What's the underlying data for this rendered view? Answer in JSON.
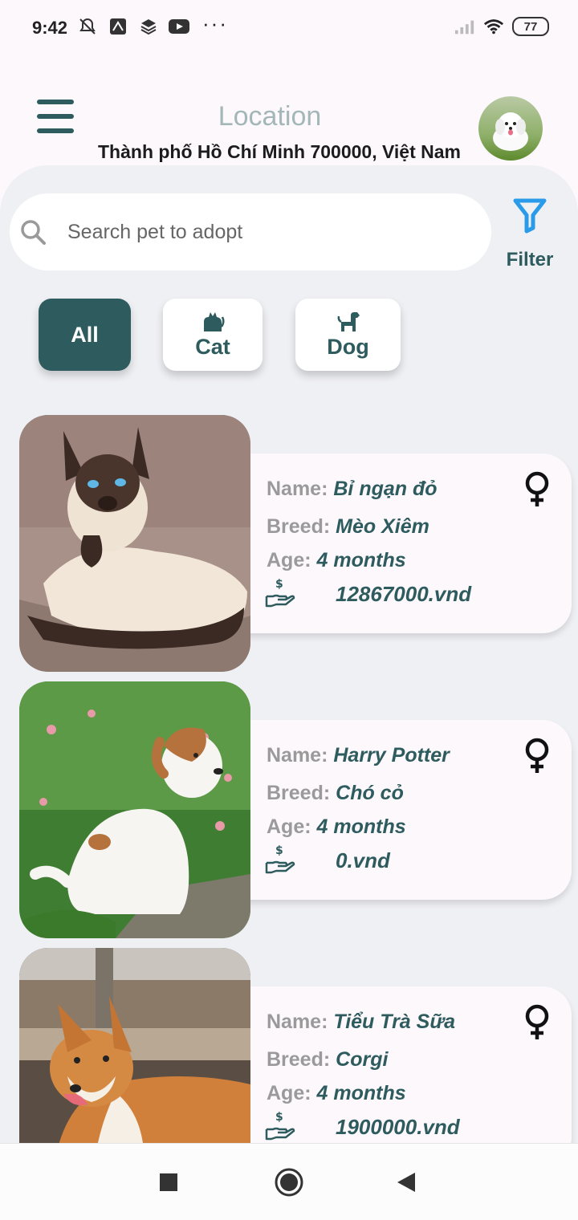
{
  "status_bar": {
    "time": "9:42",
    "battery": "77",
    "more": "···"
  },
  "header": {
    "location_label": "Location",
    "location_value": "Thành phố Hồ Chí Minh 700000, Việt Nam"
  },
  "search": {
    "placeholder": "Search pet to adopt"
  },
  "filter": {
    "label": "Filter"
  },
  "categories": [
    {
      "label": "All",
      "icon": "none",
      "active": true
    },
    {
      "label": "Cat",
      "icon": "cat-icon",
      "active": false
    },
    {
      "label": "Dog",
      "icon": "dog-icon",
      "active": false
    }
  ],
  "pet_labels": {
    "name": "Name:",
    "breed": "Breed:",
    "age": "Age:"
  },
  "pets": [
    {
      "name": "Bỉ ngạn đỏ",
      "breed": "Mèo Xiêm",
      "age": "4 months",
      "price": "12867000.vnd",
      "gender": "female-icon"
    },
    {
      "name": "Harry Potter",
      "breed": "Chó cỏ",
      "age": "4 months",
      "price": "0.vnd",
      "gender": "female-icon"
    },
    {
      "name": "Tiểu Trà Sữa",
      "breed": "Corgi",
      "age": "4 months",
      "price": "1900000.vnd",
      "gender": "female-icon"
    }
  ],
  "colors": {
    "accent": "#2e5b5e",
    "filter_icon": "#2a9be8",
    "panel_bg": "#eff0f4"
  }
}
